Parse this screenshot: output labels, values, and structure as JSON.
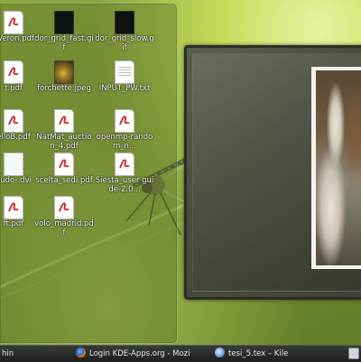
{
  "desktop": {
    "folder_items": [
      {
        "label": "aVeron.pdf",
        "icon": "pdf-icon"
      },
      {
        "label": "dor_grid_fast.gif",
        "icon": "gif-thumbnail-icon"
      },
      {
        "label": "dor_grid_slow.gif",
        "icon": "gif-thumbnail-icon"
      },
      {
        "label": "t.pdf",
        "icon": "pdf-icon"
      },
      {
        "label": "forchette.jpeg",
        "icon": "jpeg-thumbnail-icon"
      },
      {
        "label": "INPUT_PW.txt",
        "icon": "text-file-icon"
      },
      {
        "label": "elloB.pdf",
        "icon": "pdf-icon"
      },
      {
        "label": "NatMat_auction_4.pdf",
        "icon": "pdf-icon"
      },
      {
        "label": "openmp-random_n...",
        "icon": "pdf-icon"
      },
      {
        "label": "eudo-.dvi",
        "icon": "dvi-icon"
      },
      {
        "label": "scelta_sedi.pdf",
        "icon": "pdf-icon"
      },
      {
        "label": "Siesta_user guide-2.0...",
        "icon": "pdf-icon"
      },
      {
        "label": "ft.pdf",
        "icon": "pdf-icon"
      },
      {
        "label": "volo_madrid.pdf",
        "icon": "pdf-icon"
      }
    ]
  },
  "taskbar": {
    "tasks": [
      {
        "label": "hin",
        "icon": ""
      },
      {
        "label": "Login KDE-Apps.org - Mozi",
        "icon": "firefox-icon"
      },
      {
        "label": "tesi_5.tex – Kile",
        "icon": "kile-icon"
      }
    ]
  },
  "colors": {
    "pdf_red": "#cc1f1f",
    "taskbar": "#262626"
  }
}
